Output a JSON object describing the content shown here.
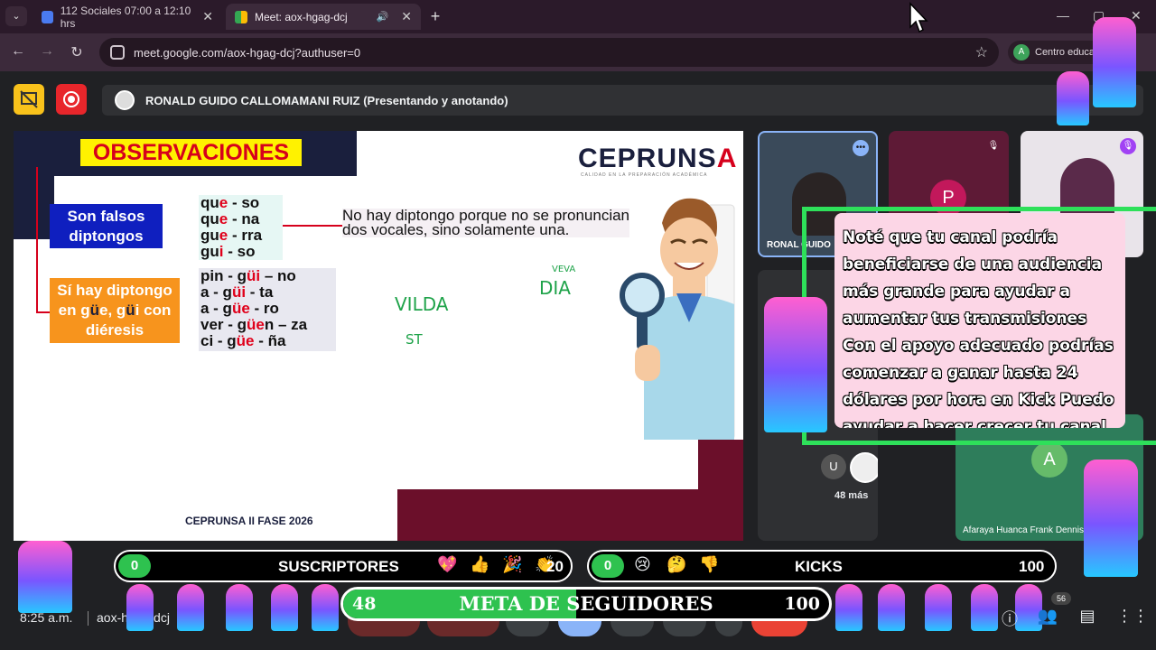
{
  "browser": {
    "tabs": [
      {
        "label": "112 Sociales 07:00 a 12:10 hrs",
        "active": false
      },
      {
        "label": "Meet: aox-hgag-dcj",
        "active": true
      }
    ],
    "url": "meet.google.com/aox-hgag-dcj?authuser=0",
    "profile_initial": "A",
    "profile_label": "Centro educativo",
    "icons": {
      "back": "←",
      "forward": "→",
      "reload": "↻",
      "star": "☆",
      "minimize": "—",
      "maximize": "▢",
      "close": "✕",
      "new_tab": "+",
      "tab_list": "⌄",
      "speaker": "🔊"
    }
  },
  "meet": {
    "presenter_label": "RONALD GUIDO CALLOMAMANI RUIZ (Presentando y anotando)",
    "time": "8:25 a.m.",
    "meeting_code": "aox-hgag-dcj",
    "more_count": "48 más",
    "more_avatar_letter": "U",
    "participant_name_1": "RONAL",
    "participant_name_1b": "GUIDO",
    "participant_letter_p": "P",
    "participant_letter_a": "A",
    "participant_name_bottom": "Afaraya Huanca Frank Dennis",
    "badge_count": "56"
  },
  "slide": {
    "title": "OBSERVACIONES",
    "logo_main": "CEPRUNS",
    "logo_accent": "A",
    "logo_sub": "CALIDAD EN LA PREPARACIÓN ACADÉMICA",
    "box_false_1": "Son falsos",
    "box_false_2": "diptongos",
    "box_true_1": "Sí hay diptongo",
    "box_true_2a": "en g",
    "box_true_2b": "ü",
    "box_true_2c": "e, g",
    "box_true_2d": "ü",
    "box_true_2e": "i con",
    "box_true_3": "diéresis",
    "words_false": [
      [
        "qu",
        "e",
        " - so"
      ],
      [
        "qu",
        "e",
        " - na"
      ],
      [
        "gu",
        "e",
        " - rra"
      ],
      [
        "gu",
        "i",
        " - so"
      ]
    ],
    "words_true": [
      [
        "pin - g",
        "üi",
        " – no"
      ],
      [
        "a - g",
        "üi",
        " - ta"
      ],
      [
        "a - g",
        "üe",
        " - ro"
      ],
      [
        "ver - g",
        "üe",
        "n – za"
      ],
      [
        "ci - g",
        "üe",
        " - ña"
      ]
    ],
    "explanation": "No hay diptongo porque no se pronuncian dos vocales, sino solamente una.",
    "footer": "CEPRUNSA II FASE 2026",
    "handwriting": [
      "VILDA",
      "ST",
      "VEVA",
      "DIA"
    ]
  },
  "overlay": {
    "promo_text": "Noté que tu canal podría beneficiarse de una audiencia más grande para ayudar a aumentar tus transmisiones Con el apoyo adecuado podrías comenzar a ganar hasta 24 dólares por hora en Kick Puedo ayudar a hacer crecer tu canal",
    "subs_label": "SUSCRIPTORES",
    "subs_count": "0",
    "subs_goal": "20",
    "kicks_label": "KICKS",
    "kicks_count": "0",
    "kicks_goal": "100",
    "goal_label": "META DE SEGUIDORES",
    "goal_current": "48",
    "goal_target": "100",
    "goal_progress": 0.48,
    "emojis_left": [
      "💖",
      "👍",
      "🎉",
      "👏"
    ],
    "emojis_right": [
      "😢",
      "🤔",
      "👎"
    ]
  },
  "colors": {
    "accent_green": "#2ec24f",
    "record_red": "#e8262b",
    "yellow": "#f9c21b",
    "promo_bg": "#fcd6e6"
  }
}
